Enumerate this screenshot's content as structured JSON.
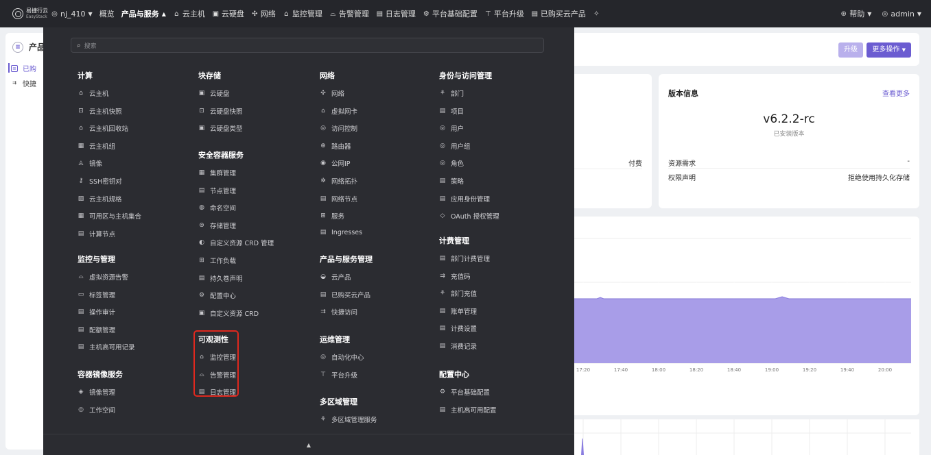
{
  "topbar": {
    "logo_cn": "易捷行云",
    "logo_en": "EasyStack",
    "region": "nj_410",
    "items": [
      {
        "label": "概览",
        "icon": "none"
      },
      {
        "label": "产品与服务",
        "icon": "none",
        "caret": "▲"
      },
      {
        "label": "云主机",
        "icon": "⌂"
      },
      {
        "label": "云硬盘",
        "icon": "▣"
      },
      {
        "label": "网络",
        "icon": "✣"
      },
      {
        "label": "监控管理",
        "icon": "⌂"
      },
      {
        "label": "告警管理",
        "icon": "⌓"
      },
      {
        "label": "日志管理",
        "icon": "▤"
      },
      {
        "label": "平台基础配置",
        "icon": "⚙"
      },
      {
        "label": "平台升级",
        "icon": "⊤"
      },
      {
        "label": "已购买云产品",
        "icon": "▤"
      }
    ],
    "help": "帮助",
    "user": "admin"
  },
  "sidebar": {
    "title": "产品",
    "items": [
      {
        "label": "已购"
      },
      {
        "label": "快捷"
      }
    ]
  },
  "header": {
    "upgrade_label": "升级",
    "more_label": "更多操作"
  },
  "mid": {
    "pay_label": "付费"
  },
  "version": {
    "title": "版本信息",
    "more": "查看更多",
    "number": "v6.2.2-rc",
    "subtitle": "已安装版本",
    "row1_label": "资源需求",
    "row1_value": "-",
    "row2_label": "权限声明",
    "row2_value": "拒绝使用持久化存储"
  },
  "chart_data": {
    "type": "area",
    "x": [
      "17:20",
      "17:40",
      "18:00",
      "18:20",
      "18:40",
      "19:00",
      "19:20",
      "19:40",
      "20:00"
    ],
    "colors": {
      "fill": "#a89de8",
      "line": "#8a7de0"
    }
  },
  "menu": {
    "search_placeholder": "搜索",
    "footer_caret": "▲",
    "col1": {
      "compute_title": "计算",
      "compute_items": [
        {
          "label": "云主机",
          "icon": "⌂"
        },
        {
          "label": "云主机快照",
          "icon": "⊡"
        },
        {
          "label": "云主机回收站",
          "icon": "⌂"
        },
        {
          "label": "云主机组",
          "icon": "▦"
        },
        {
          "label": "镜像",
          "icon": "◬"
        },
        {
          "label": "SSH密钥对",
          "icon": "⚷"
        },
        {
          "label": "云主机规格",
          "icon": "▧"
        },
        {
          "label": "可用区与主机集合",
          "icon": "▦"
        },
        {
          "label": "计算节点",
          "icon": "▤"
        }
      ],
      "monitor_title": "监控与管理",
      "monitor_items": [
        {
          "label": "虚拟资源告警",
          "icon": "⌓"
        },
        {
          "label": "标签管理",
          "icon": "▭"
        },
        {
          "label": "操作审计",
          "icon": "▤"
        },
        {
          "label": "配额管理",
          "icon": "▤"
        },
        {
          "label": "主机高可用记录",
          "icon": "▤"
        }
      ],
      "registry_title": "容器镜像服务",
      "registry_items": [
        {
          "label": "镜像管理",
          "icon": "◈"
        },
        {
          "label": "工作空间",
          "icon": "◎"
        }
      ]
    },
    "col2": {
      "block_title": "块存储",
      "block_items": [
        {
          "label": "云硬盘",
          "icon": "▣"
        },
        {
          "label": "云硬盘快照",
          "icon": "⊡"
        },
        {
          "label": "云硬盘类型",
          "icon": "▣"
        }
      ],
      "container_title": "安全容器服务",
      "container_items": [
        {
          "label": "集群管理",
          "icon": "▦"
        },
        {
          "label": "节点管理",
          "icon": "▤"
        },
        {
          "label": "命名空间",
          "icon": "◍"
        },
        {
          "label": "存储管理",
          "icon": "⊜"
        },
        {
          "label": "自定义资源 CRD 管理",
          "icon": "◐"
        },
        {
          "label": "工作负载",
          "icon": "⊞"
        },
        {
          "label": "持久卷声明",
          "icon": "▤"
        },
        {
          "label": "配置中心",
          "icon": "⚙"
        },
        {
          "label": "自定义资源 CRD",
          "icon": "▣"
        }
      ],
      "observe_title": "可观测性",
      "observe_items": [
        {
          "label": "监控管理",
          "icon": "⌂"
        },
        {
          "label": "告警管理",
          "icon": "⌓"
        },
        {
          "label": "日志管理",
          "icon": "▤"
        }
      ]
    },
    "col3": {
      "network_title": "网络",
      "network_items": [
        {
          "label": "网络",
          "icon": "✣"
        },
        {
          "label": "虚拟网卡",
          "icon": "⌂"
        },
        {
          "label": "访问控制",
          "icon": "◎"
        },
        {
          "label": "路由器",
          "icon": "⊕"
        },
        {
          "label": "公网IP",
          "icon": "◉"
        },
        {
          "label": "网络拓扑",
          "icon": "✲"
        },
        {
          "label": "网络节点",
          "icon": "▤"
        },
        {
          "label": "服务",
          "icon": "⊞"
        },
        {
          "label": "Ingresses",
          "icon": "▤"
        }
      ],
      "product_title": "产品与服务管理",
      "product_items": [
        {
          "label": "云产品",
          "icon": "◒"
        },
        {
          "label": "已购买云产品",
          "icon": "▤"
        },
        {
          "label": "快捷访问",
          "icon": "⇉"
        }
      ],
      "ops_title": "运维管理",
      "ops_items": [
        {
          "label": "自动化中心",
          "icon": "◎"
        },
        {
          "label": "平台升级",
          "icon": "⊤"
        }
      ],
      "multi_title": "多区域管理",
      "multi_items": [
        {
          "label": "多区域管理服务",
          "icon": "⚘"
        }
      ]
    },
    "col4": {
      "iam_title": "身份与访问管理",
      "iam_items": [
        {
          "label": "部门",
          "icon": "⚘"
        },
        {
          "label": "项目",
          "icon": "▤"
        },
        {
          "label": "用户",
          "icon": "◎"
        },
        {
          "label": "用户组",
          "icon": "◎"
        },
        {
          "label": "角色",
          "icon": "◎"
        },
        {
          "label": "策略",
          "icon": "▤"
        },
        {
          "label": "应用身份管理",
          "icon": "▤"
        },
        {
          "label": "OAuth 授权管理",
          "icon": "◇"
        }
      ],
      "billing_title": "计费管理",
      "billing_items": [
        {
          "label": "部门计费管理",
          "icon": "▤"
        },
        {
          "label": "充值码",
          "icon": "⇉"
        },
        {
          "label": "部门充值",
          "icon": "⚘"
        },
        {
          "label": "账单管理",
          "icon": "▤"
        },
        {
          "label": "计费设置",
          "icon": "▤"
        },
        {
          "label": "消费记录",
          "icon": "▤"
        }
      ],
      "config_title": "配置中心",
      "config_items": [
        {
          "label": "平台基础配置",
          "icon": "⚙"
        },
        {
          "label": "主机高可用配置",
          "icon": "▤"
        }
      ]
    }
  }
}
